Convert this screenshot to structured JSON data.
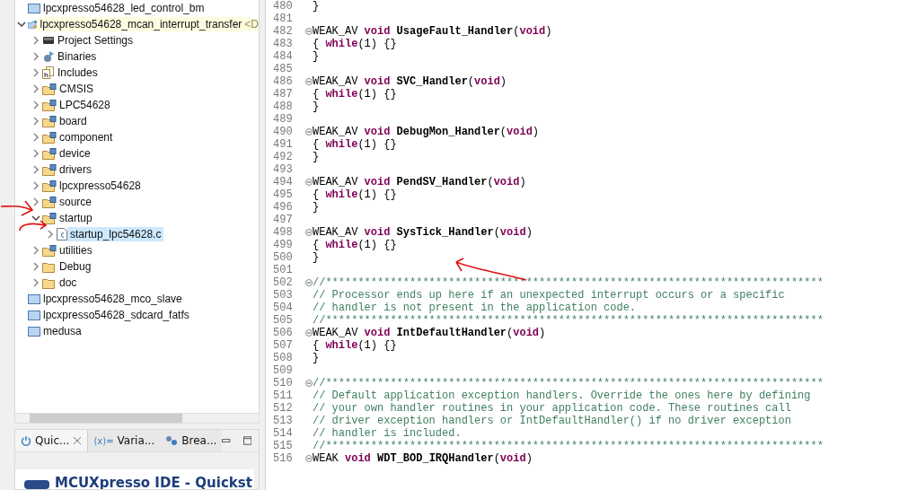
{
  "project_explorer": {
    "tree": [
      {
        "label": "lpcxpresso54628_led_control_bm",
        "kind": "project",
        "selected": false
      },
      {
        "label": "lpcxpresso54628_mcan_interrupt_transfer",
        "decoration": "<D",
        "kind": "cproject",
        "expanded": true,
        "selected": false,
        "children": [
          {
            "label": "Project Settings",
            "kind": "settings",
            "expanded": false,
            "selected": false
          },
          {
            "label": "Binaries",
            "kind": "binaries",
            "expanded": false,
            "selected": false
          },
          {
            "label": "Includes",
            "kind": "includes",
            "expanded": false,
            "selected": false
          },
          {
            "label": "CMSIS",
            "kind": "srcfolder",
            "expanded": false,
            "selected": false
          },
          {
            "label": "LPC54628",
            "kind": "srcfolder",
            "expanded": false,
            "selected": false
          },
          {
            "label": "board",
            "kind": "srcfolder",
            "expanded": false,
            "selected": false
          },
          {
            "label": "component",
            "kind": "srcfolder",
            "expanded": false,
            "selected": false
          },
          {
            "label": "device",
            "kind": "srcfolder",
            "expanded": false,
            "selected": false
          },
          {
            "label": "drivers",
            "kind": "srcfolder",
            "expanded": false,
            "selected": false
          },
          {
            "label": "lpcxpresso54628",
            "kind": "srcfolder",
            "expanded": false,
            "selected": false
          },
          {
            "label": "source",
            "kind": "srcfolder",
            "expanded": false,
            "selected": false
          },
          {
            "label": "startup",
            "kind": "srcfolder",
            "expanded": true,
            "selected": false,
            "children": [
              {
                "label": "startup_lpc54628.c",
                "kind": "cfile",
                "expanded": false,
                "selected": true
              }
            ]
          },
          {
            "label": "utilities",
            "kind": "srcfolder",
            "expanded": false,
            "selected": false
          },
          {
            "label": "Debug",
            "kind": "folder",
            "expanded": false,
            "selected": false
          },
          {
            "label": "doc",
            "kind": "folder",
            "expanded": false,
            "selected": false
          }
        ]
      },
      {
        "label": "lpcxpresso54628_mco_slave",
        "kind": "project",
        "selected": false
      },
      {
        "label": "lpcxpresso54628_sdcard_fatfs",
        "kind": "project",
        "selected": false
      },
      {
        "label": "medusa",
        "kind": "project",
        "selected": false
      }
    ]
  },
  "bottom_panel": {
    "tabs": [
      {
        "label": "Quic...",
        "kind": "quickstart",
        "selected": true
      },
      {
        "label": "Varia...",
        "kind": "variables",
        "icon_text": "(x)=",
        "selected": false
      },
      {
        "label": "Brea...",
        "kind": "breakpoints",
        "selected": false
      }
    ],
    "content_title": "MCUXpresso IDE - Quickst"
  },
  "editor": {
    "lines": [
      {
        "number": "480",
        "fold": false,
        "tokens": [
          {
            "kind": "plain",
            "text": "}"
          }
        ]
      },
      {
        "number": "481",
        "fold": false
      },
      {
        "number": "482",
        "fold": true,
        "tokens": [
          {
            "kind": "plain",
            "text": "WEAK_AV "
          },
          {
            "kind": "keyword",
            "text": "void"
          },
          {
            "kind": "bold",
            "text": " UsageFault_Handler"
          },
          {
            "kind": "plain",
            "text": "("
          },
          {
            "kind": "keyword",
            "text": "void"
          },
          {
            "kind": "plain",
            "text": ")"
          }
        ]
      },
      {
        "number": "483",
        "fold": false,
        "tokens": [
          {
            "kind": "plain",
            "text": "{ "
          },
          {
            "kind": "keyword",
            "text": "while"
          },
          {
            "kind": "plain",
            "text": "(1) {}"
          }
        ]
      },
      {
        "number": "484",
        "fold": false,
        "tokens": [
          {
            "kind": "plain",
            "text": "}"
          }
        ]
      },
      {
        "number": "485",
        "fold": false
      },
      {
        "number": "486",
        "fold": true,
        "tokens": [
          {
            "kind": "plain",
            "text": "WEAK_AV "
          },
          {
            "kind": "keyword",
            "text": "void"
          },
          {
            "kind": "bold",
            "text": " SVC_Handler"
          },
          {
            "kind": "plain",
            "text": "("
          },
          {
            "kind": "keyword",
            "text": "void"
          },
          {
            "kind": "plain",
            "text": ")"
          }
        ]
      },
      {
        "number": "487",
        "fold": false,
        "tokens": [
          {
            "kind": "plain",
            "text": "{ "
          },
          {
            "kind": "keyword",
            "text": "while"
          },
          {
            "kind": "plain",
            "text": "(1) {}"
          }
        ]
      },
      {
        "number": "488",
        "fold": false,
        "tokens": [
          {
            "kind": "plain",
            "text": "}"
          }
        ]
      },
      {
        "number": "489",
        "fold": false
      },
      {
        "number": "490",
        "fold": true,
        "tokens": [
          {
            "kind": "plain",
            "text": "WEAK_AV "
          },
          {
            "kind": "keyword",
            "text": "void"
          },
          {
            "kind": "bold",
            "text": " DebugMon_Handler"
          },
          {
            "kind": "plain",
            "text": "("
          },
          {
            "kind": "keyword",
            "text": "void"
          },
          {
            "kind": "plain",
            "text": ")"
          }
        ]
      },
      {
        "number": "491",
        "fold": false,
        "tokens": [
          {
            "kind": "plain",
            "text": "{ "
          },
          {
            "kind": "keyword",
            "text": "while"
          },
          {
            "kind": "plain",
            "text": "(1) {}"
          }
        ]
      },
      {
        "number": "492",
        "fold": false,
        "tokens": [
          {
            "kind": "plain",
            "text": "}"
          }
        ]
      },
      {
        "number": "493",
        "fold": false
      },
      {
        "number": "494",
        "fold": true,
        "tokens": [
          {
            "kind": "plain",
            "text": "WEAK_AV "
          },
          {
            "kind": "keyword",
            "text": "void"
          },
          {
            "kind": "bold",
            "text": " PendSV_Handler"
          },
          {
            "kind": "plain",
            "text": "("
          },
          {
            "kind": "keyword",
            "text": "void"
          },
          {
            "kind": "plain",
            "text": ")"
          }
        ]
      },
      {
        "number": "495",
        "fold": false,
        "tokens": [
          {
            "kind": "plain",
            "text": "{ "
          },
          {
            "kind": "keyword",
            "text": "while"
          },
          {
            "kind": "plain",
            "text": "(1) {}"
          }
        ]
      },
      {
        "number": "496",
        "fold": false,
        "tokens": [
          {
            "kind": "plain",
            "text": "}"
          }
        ]
      },
      {
        "number": "497",
        "fold": false
      },
      {
        "number": "498",
        "fold": true,
        "tokens": [
          {
            "kind": "plain",
            "text": "WEAK_AV "
          },
          {
            "kind": "keyword",
            "text": "void"
          },
          {
            "kind": "bold",
            "text": " SysTick_Handler"
          },
          {
            "kind": "plain",
            "text": "("
          },
          {
            "kind": "keyword",
            "text": "void"
          },
          {
            "kind": "plain",
            "text": ")"
          }
        ]
      },
      {
        "number": "499",
        "fold": false,
        "tokens": [
          {
            "kind": "plain",
            "text": "{ "
          },
          {
            "kind": "keyword",
            "text": "while"
          },
          {
            "kind": "plain",
            "text": "(1) {}"
          }
        ]
      },
      {
        "number": "500",
        "fold": false,
        "tokens": [
          {
            "kind": "plain",
            "text": "}"
          }
        ]
      },
      {
        "number": "501",
        "fold": false
      },
      {
        "number": "502",
        "fold": true,
        "tokens": [
          {
            "kind": "comment",
            "text": "//*****************************************************************************"
          }
        ]
      },
      {
        "number": "503",
        "fold": false,
        "tokens": [
          {
            "kind": "comment",
            "text": "// Processor ends up here if an unexpected interrupt occurs or a specific"
          }
        ]
      },
      {
        "number": "504",
        "fold": false,
        "tokens": [
          {
            "kind": "comment",
            "text": "// handler is not present in the application code."
          }
        ]
      },
      {
        "number": "505",
        "fold": false,
        "tokens": [
          {
            "kind": "comment",
            "text": "//*****************************************************************************"
          }
        ]
      },
      {
        "number": "506",
        "fold": true,
        "tokens": [
          {
            "kind": "plain",
            "text": "WEAK_AV "
          },
          {
            "kind": "keyword",
            "text": "void"
          },
          {
            "kind": "bold",
            "text": " IntDefaultHandler"
          },
          {
            "kind": "plain",
            "text": "("
          },
          {
            "kind": "keyword",
            "text": "void"
          },
          {
            "kind": "plain",
            "text": ")"
          }
        ]
      },
      {
        "number": "507",
        "fold": false,
        "tokens": [
          {
            "kind": "plain",
            "text": "{ "
          },
          {
            "kind": "keyword",
            "text": "while"
          },
          {
            "kind": "plain",
            "text": "(1) {}"
          }
        ]
      },
      {
        "number": "508",
        "fold": false,
        "tokens": [
          {
            "kind": "plain",
            "text": "}"
          }
        ]
      },
      {
        "number": "509",
        "fold": false
      },
      {
        "number": "510",
        "fold": true,
        "tokens": [
          {
            "kind": "comment",
            "text": "//*****************************************************************************"
          }
        ]
      },
      {
        "number": "511",
        "fold": false,
        "tokens": [
          {
            "kind": "comment",
            "text": "// Default application exception handlers. Override the ones here by defining"
          }
        ]
      },
      {
        "number": "512",
        "fold": false,
        "tokens": [
          {
            "kind": "comment",
            "text": "// your own handler routines in your application code. These routines call"
          }
        ]
      },
      {
        "number": "513",
        "fold": false,
        "tokens": [
          {
            "kind": "comment",
            "text": "// driver exception handlers or IntDefaultHandler() if no driver exception"
          }
        ]
      },
      {
        "number": "514",
        "fold": false,
        "tokens": [
          {
            "kind": "comment",
            "text": "// handler is included."
          }
        ]
      },
      {
        "number": "515",
        "fold": false,
        "tokens": [
          {
            "kind": "comment",
            "text": "//*****************************************************************************"
          }
        ]
      },
      {
        "number": "516",
        "fold": true,
        "tokens": [
          {
            "kind": "plain",
            "text": "WEAK "
          },
          {
            "kind": "keyword",
            "text": "void"
          },
          {
            "kind": "bold",
            "text": " WDT_BOD_IRQHandler"
          },
          {
            "kind": "plain",
            "text": "("
          },
          {
            "kind": "keyword",
            "text": "void"
          },
          {
            "kind": "plain",
            "text": ")"
          }
        ]
      }
    ]
  }
}
